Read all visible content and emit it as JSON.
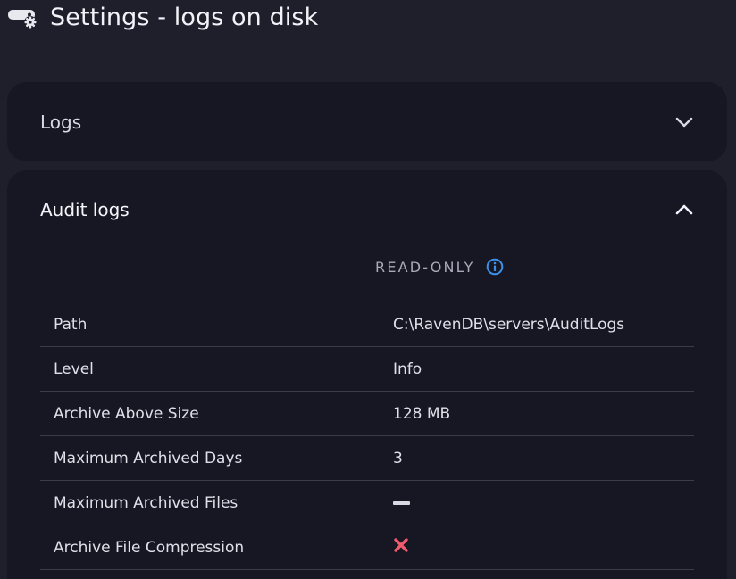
{
  "header": {
    "title": "Settings - logs on disk",
    "icon": "server-settings-icon"
  },
  "panels": {
    "logs": {
      "title": "Logs",
      "expanded": false
    },
    "audit": {
      "title": "Audit logs",
      "expanded": true,
      "readonly_label": "READ-ONLY",
      "rows": [
        {
          "label": "Path",
          "value": "C:\\RavenDB\\servers\\AuditLogs"
        },
        {
          "label": "Level",
          "value": "Info"
        },
        {
          "label": "Archive Above Size",
          "value": "128 MB"
        },
        {
          "label": "Maximum Archived Days",
          "value": "3"
        },
        {
          "label": "Maximum Archived Files",
          "value": "",
          "icon": "dash-icon"
        },
        {
          "label": "Archive File Compression",
          "value": "",
          "icon": "cross-icon"
        }
      ]
    }
  },
  "colors": {
    "background": "#1e1f2b",
    "panel": "#161722",
    "accent_info": "#3d8fe8",
    "cross_red": "#f05a6e",
    "divider": "#3a3c4c"
  }
}
